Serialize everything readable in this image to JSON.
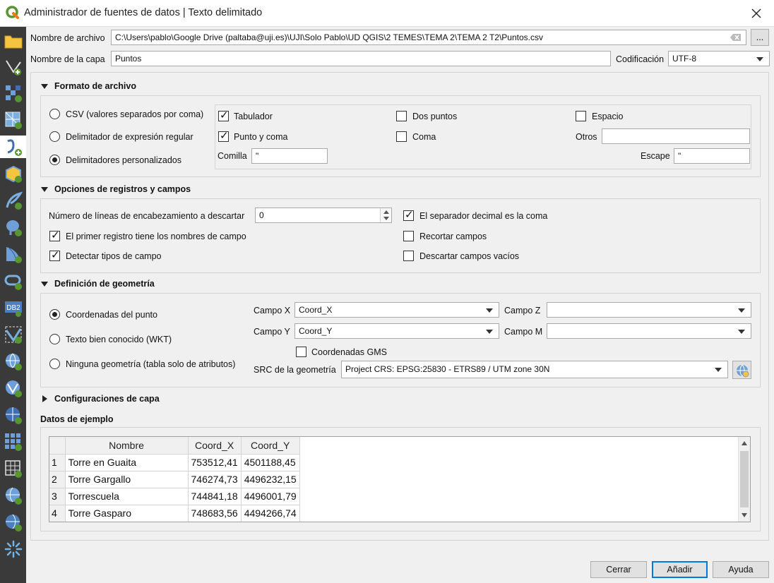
{
  "window": {
    "title": "Administrador de fuentes de datos | Texto delimitado"
  },
  "sidebar": {
    "items": [
      {
        "icon": "folder-icon"
      },
      {
        "icon": "vector-layer-icon"
      },
      {
        "icon": "raster-layer-icon"
      },
      {
        "icon": "mesh-layer-icon"
      },
      {
        "icon": "delimited-text-icon",
        "selected": true
      },
      {
        "icon": "geopackage-icon"
      },
      {
        "icon": "spatialite-icon"
      },
      {
        "icon": "postgresql-icon"
      },
      {
        "icon": "mssql-icon"
      },
      {
        "icon": "oracle-icon"
      },
      {
        "icon": "db2-icon",
        "text": "DB2"
      },
      {
        "icon": "virtual-layer-icon"
      },
      {
        "icon": "wms-wmts-icon"
      },
      {
        "icon": "wfs-icon"
      },
      {
        "icon": "wcs-icon"
      },
      {
        "icon": "xyz-icon"
      },
      {
        "icon": "vector-tile-icon"
      },
      {
        "icon": "arcgis-mapserver-icon"
      },
      {
        "icon": "arcgis-featureserver-icon"
      },
      {
        "icon": "geonode-icon"
      }
    ]
  },
  "file": {
    "label": "Nombre de archivo",
    "value": "C:\\Users\\pablo\\Google Drive (paltaba@uji.es)\\UJI\\Solo Pablo\\UD QGIS\\2 TEMES\\TEMA 2\\TEMA 2 T2\\Puntos.csv",
    "browse_label": "..."
  },
  "layer": {
    "label": "Nombre de la capa",
    "value": "Puntos",
    "encoding_label": "Codificación",
    "encoding_value": "UTF-8"
  },
  "file_format": {
    "title": "Formato de archivo",
    "radio_csv": "CSV (valores separados por coma)",
    "radio_regex": "Delimitador de expresión regular",
    "radio_custom": "Delimitadores personalizados",
    "tab": "Tabulador",
    "colon": "Dos puntos",
    "space": "Espacio",
    "semicolon": "Punto y coma",
    "comma": "Coma",
    "others": "Otros",
    "others_value": "",
    "quote_label": "Comilla",
    "quote_value": "\"",
    "escape_label": "Escape",
    "escape_value": "\""
  },
  "records": {
    "title": "Opciones de registros y campos",
    "skip_label": "Número de líneas de encabezamiento a descartar",
    "skip_value": "0",
    "decimal_comma": "El separador decimal es la coma",
    "first_record_names": "El primer registro tiene los nombres de campo",
    "trim_fields": "Recortar campos",
    "detect_types": "Detectar tipos de campo",
    "discard_empty": "Descartar campos vacíos"
  },
  "geometry": {
    "title": "Definición de geometría",
    "radio_point": "Coordenadas del punto",
    "radio_wkt": "Texto bien conocido (WKT)",
    "radio_none": "Ninguna geometría (tabla solo de atributos)",
    "x_label": "Campo X",
    "x_value": "Coord_X",
    "z_label": "Campo Z",
    "z_value": "",
    "y_label": "Campo Y",
    "y_value": "Coord_Y",
    "m_label": "Campo M",
    "m_value": "",
    "dms_label": "Coordenadas GMS",
    "crs_label": "SRC de la geometría",
    "crs_value": "Project CRS: EPSG:25830 - ETRS89 / UTM zone 30N"
  },
  "layer_settings": {
    "title": "Configuraciones de capa"
  },
  "sample": {
    "title": "Datos de ejemplo",
    "columns": [
      "Nombre",
      "Coord_X",
      "Coord_Y"
    ],
    "rows": [
      {
        "n": "1",
        "nombre": "Torre en Guaita",
        "x": "753512,41",
        "y": "4501188,45"
      },
      {
        "n": "2",
        "nombre": "Torre Gargallo",
        "x": "746274,73",
        "y": "4496232,15"
      },
      {
        "n": "3",
        "nombre": "Torrescuela",
        "x": "744841,18",
        "y": "4496001,79"
      },
      {
        "n": "4",
        "nombre": "Torre Gasparo",
        "x": "748683,56",
        "y": "4494266,74"
      }
    ]
  },
  "buttons": {
    "close": "Cerrar",
    "add": "Añadir",
    "help": "Ayuda"
  },
  "colors": {
    "sidebar_bg": "#3a3a3a",
    "accent": "#0078d7",
    "qgis_green": "#589632",
    "qgis_yellow": "#ee7913"
  }
}
